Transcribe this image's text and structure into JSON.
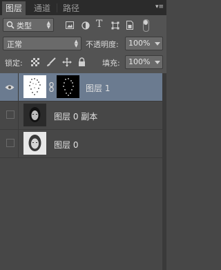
{
  "tabs": [
    {
      "label": "图层",
      "active": true
    },
    {
      "label": "通道",
      "active": false
    },
    {
      "label": "路径",
      "active": false
    }
  ],
  "filter": {
    "kind_label": "类型"
  },
  "blend": {
    "mode": "正常",
    "opacity_label": "不透明度:",
    "opacity_value": "100%"
  },
  "lock": {
    "label": "锁定:",
    "fill_label": "填充:",
    "fill_value": "100%"
  },
  "layers": [
    {
      "name": "图层 1",
      "selected": true,
      "visible": true
    },
    {
      "name": "图层 0 副本",
      "selected": false,
      "visible": false
    },
    {
      "name": "图层 0",
      "selected": false,
      "visible": false
    }
  ],
  "colors": {
    "panel": "#535353",
    "selection": "#6b7b90",
    "list": "#474747"
  }
}
